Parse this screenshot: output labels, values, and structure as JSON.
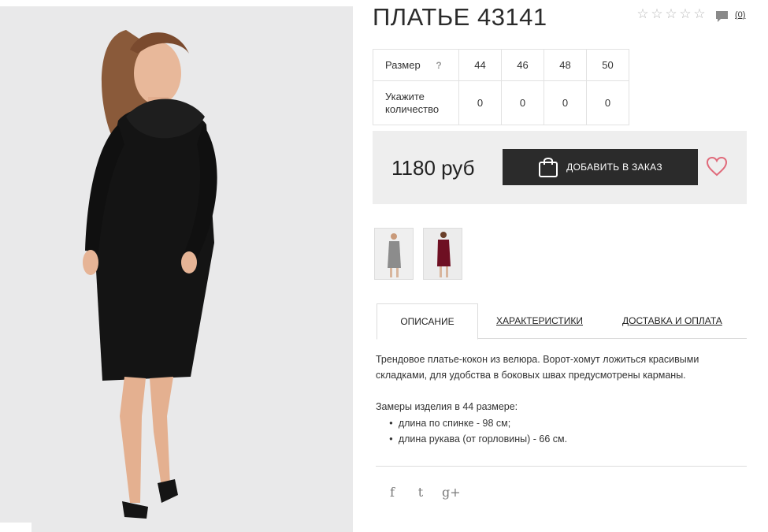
{
  "product": {
    "title": "ПЛАТЬЕ 43141",
    "rating": {
      "stars_filled": 0,
      "stars_total": 5
    },
    "comments_count": "(0)"
  },
  "sizes": {
    "header_label": "Размер",
    "help_label": "?",
    "quantity_label_line1": "Укажите",
    "quantity_label_line2": "количество",
    "columns": [
      "44",
      "46",
      "48",
      "50"
    ],
    "quantities": [
      "0",
      "0",
      "0",
      "0"
    ]
  },
  "buy": {
    "price": "1180 руб",
    "add_button_label": "ДОБАВИТЬ В ЗАКАЗ"
  },
  "thumbnails": [
    {
      "icon": "grey-dress-thumbnail"
    },
    {
      "icon": "burgundy-dress-thumbnail"
    }
  ],
  "tabs": {
    "description": "ОПИСАНИЕ",
    "characteristics": "ХАРАКТЕРИСТИКИ",
    "delivery": "ДОСТАВКА И ОПЛАТА"
  },
  "description": {
    "text": "Трендовое платье-кокон из велюра. Ворот-хомут ложиться красивыми складками, для удобства в боковых швах предусмотрены карманы.",
    "measure_title": "Замеры изделия в 44 размере:",
    "measures": [
      "длина по спинке - 98 см;",
      "длина рукава (от горловины) - 66 см."
    ]
  },
  "social": {
    "facebook": "f",
    "twitter": "t",
    "gplus": "g+"
  },
  "colors": {
    "button": "#2b2b2b",
    "heart": "#e06a7a",
    "buybox_bg": "#eeeeee"
  }
}
